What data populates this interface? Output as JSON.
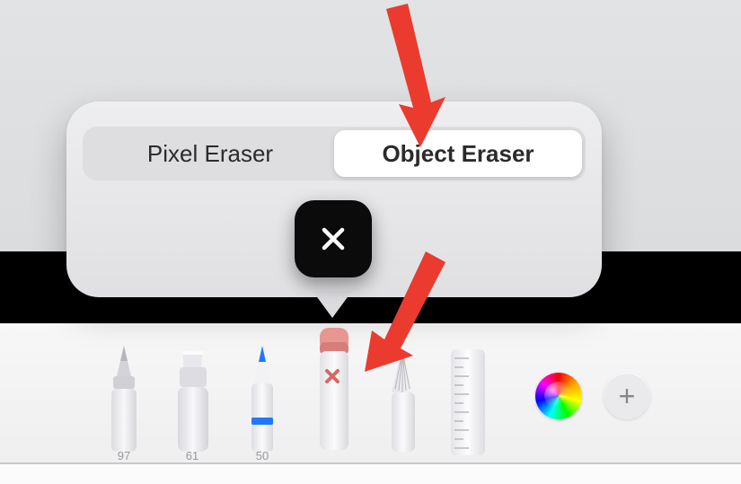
{
  "popover": {
    "pixel_label": "Pixel Eraser",
    "object_label": "Object Eraser",
    "selected": "object"
  },
  "tools": {
    "pen": {
      "size_label": "97"
    },
    "marker": {
      "size_label": "61"
    },
    "pencil": {
      "size_label": "50"
    },
    "eraser": {
      "selected": true
    },
    "lasso": {},
    "ruler": {}
  },
  "icons": {
    "close": "close-icon",
    "plus": "+"
  },
  "annotation": {
    "top_arrow_target": "Object Eraser",
    "bottom_arrow_target": "Eraser tool"
  }
}
